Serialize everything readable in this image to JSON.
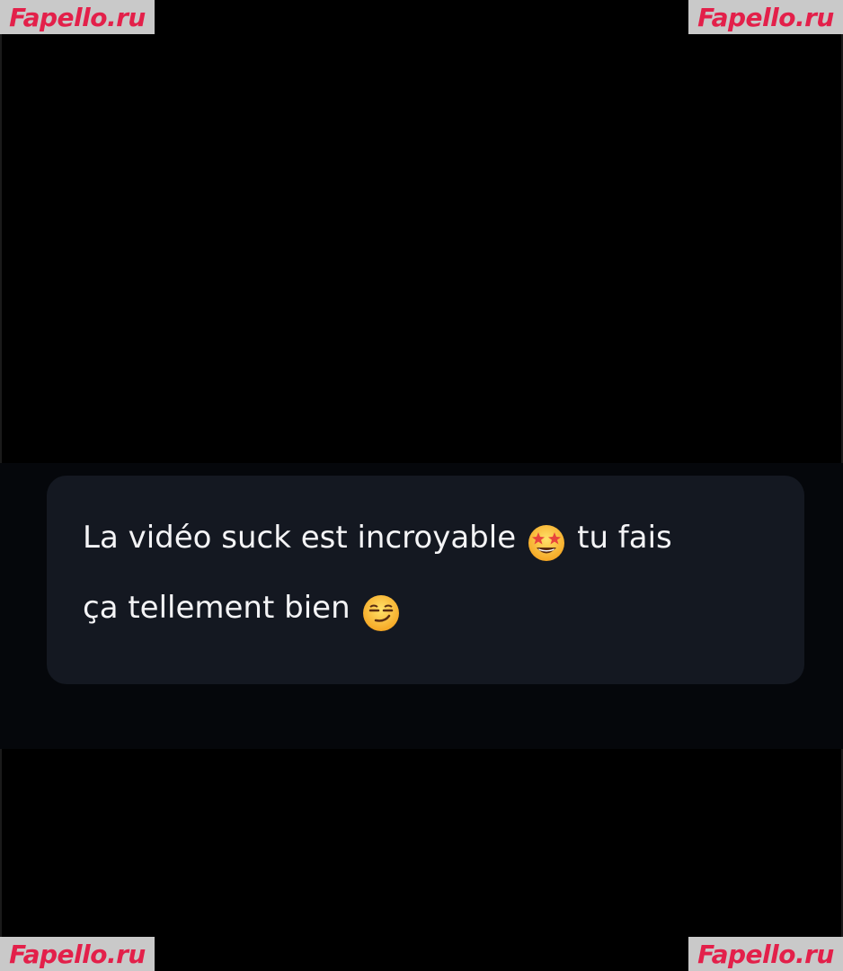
{
  "watermark": {
    "text": "Fapello.ru",
    "color": "#e3204a"
  },
  "message": {
    "line1_part1": "La vidéo suck est incroyable",
    "line1_part2": "tu fais",
    "line2_part1": "ça tellement bien",
    "emoji1": "star-struck-emoji-icon",
    "emoji2": "smirking-face-emoji-icon"
  },
  "colors": {
    "background": "#000000",
    "bubble": "#141821",
    "text": "#f4f4f6"
  }
}
